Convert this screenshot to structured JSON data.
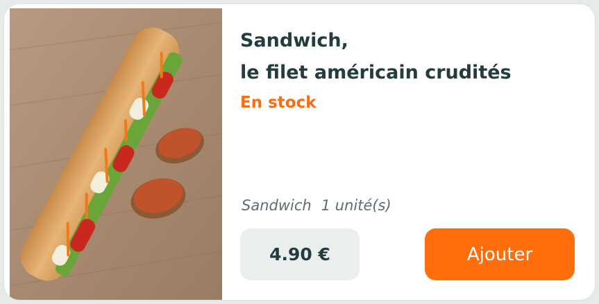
{
  "product": {
    "title_line1": "Sandwich,",
    "title_line2": "le filet américain crudités",
    "stock_status": "En stock",
    "category": "Sandwich",
    "unit": "1 unité(s)",
    "price": "4.90 €",
    "add_label": "Ajouter"
  },
  "colors": {
    "accent": "#ff6e0a",
    "title": "#243b3f",
    "price_bg": "#eaeeed"
  }
}
